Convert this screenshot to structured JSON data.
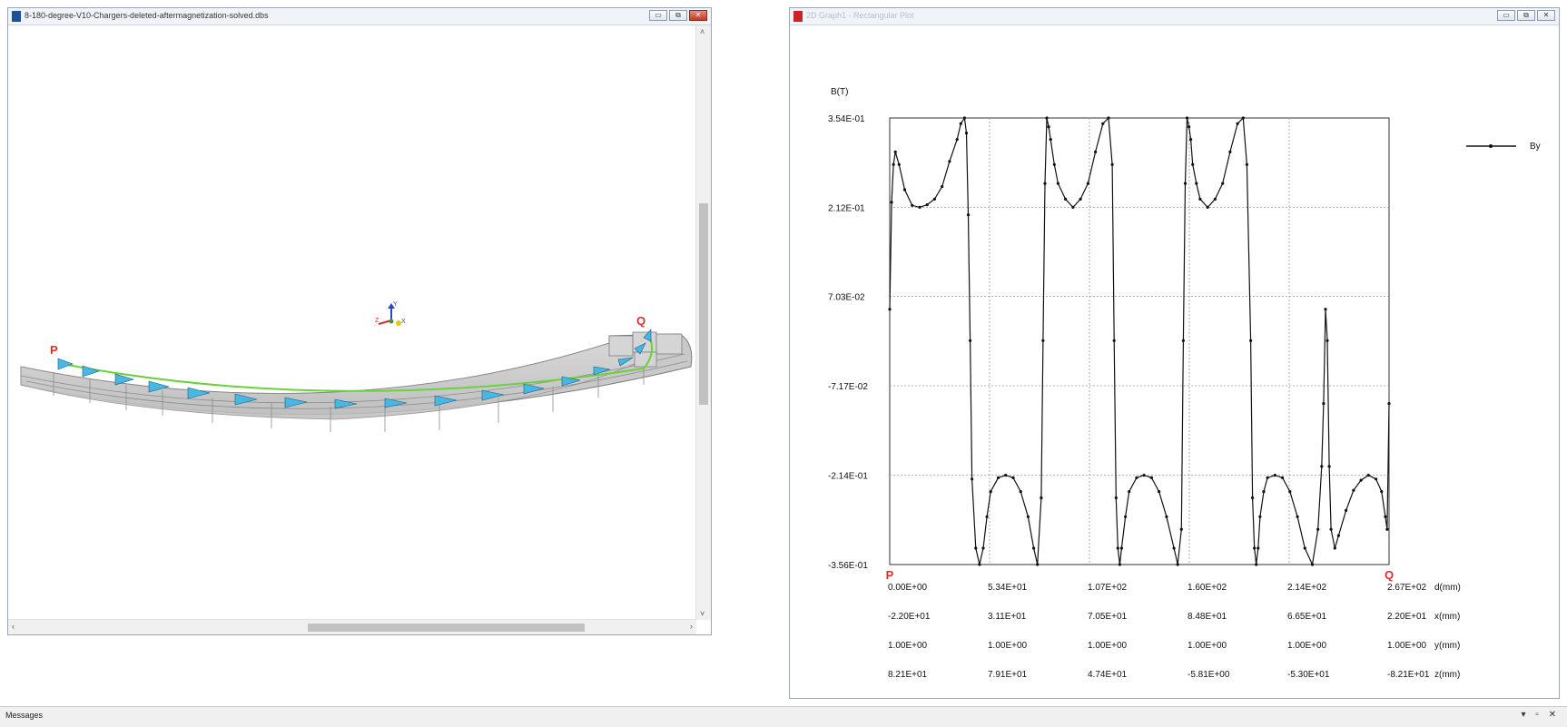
{
  "left_window": {
    "title": "8-180-degree-V10-Chargers-deleted-aftermagnetization-solved.dbs",
    "buttons": [
      "▭",
      "⧉",
      "✕"
    ],
    "labels": {
      "start": "P",
      "end": "Q"
    },
    "axis_labels": {
      "y": "Y",
      "x": "X",
      "z": "Z"
    }
  },
  "right_window": {
    "title": "2D Graph1 - Rectangular Plot",
    "buttons": [
      "▭",
      "⧉",
      "✕"
    ]
  },
  "statusbar": {
    "label": "Messages",
    "controls": "▾ ▫ ✕"
  },
  "chart_data": {
    "type": "line",
    "ylabel": "B(T)",
    "legend": {
      "entries": [
        "By"
      ],
      "position": "top-right"
    },
    "y_ticks": [
      "3.54E-01",
      "2.12E-01",
      "7.03E-02",
      "-7.17E-02",
      "-2.14E-01",
      "-3.56E-01"
    ],
    "ylim": [
      -0.356,
      0.354
    ],
    "xlim": [
      0,
      267
    ],
    "grid": true,
    "endpoint_labels": [
      "P",
      "Q"
    ],
    "x_axes": [
      {
        "label": "d(mm)",
        "ticks": [
          "0.00E+00",
          "5.34E+01",
          "1.07E+02",
          "1.60E+02",
          "2.14E+02",
          "2.67E+02"
        ]
      },
      {
        "label": "x(mm)",
        "ticks": [
          "-2.20E+01",
          "3.11E+01",
          "7.05E+01",
          "8.48E+01",
          "6.65E+01",
          "2.20E+01"
        ]
      },
      {
        "label": "y(mm)",
        "ticks": [
          "1.00E+00",
          "1.00E+00",
          "1.00E+00",
          "1.00E+00",
          "1.00E+00",
          "1.00E+00"
        ]
      },
      {
        "label": "z(mm)",
        "ticks": [
          "8.21E+01",
          "7.91E+01",
          "4.74E+01",
          "-5.81E+00",
          "-5.30E+01",
          "-8.21E+01"
        ]
      }
    ],
    "series": [
      {
        "name": "By",
        "x": [
          0,
          1,
          2,
          3,
          5,
          8,
          12,
          16,
          20,
          24,
          28,
          32,
          36,
          38,
          40,
          41,
          42,
          43,
          44,
          46,
          48,
          50,
          52,
          54,
          58,
          62,
          66,
          70,
          74,
          77,
          79,
          81,
          82,
          83,
          84,
          85,
          86,
          88,
          90,
          94,
          98,
          102,
          106,
          110,
          114,
          117,
          119,
          120,
          121,
          122,
          123,
          124,
          126,
          128,
          132,
          136,
          140,
          144,
          148,
          152,
          154,
          156,
          157,
          158,
          159,
          160,
          161,
          162,
          164,
          166,
          170,
          174,
          178,
          182,
          186,
          189,
          191,
          193,
          194,
          195,
          196,
          197,
          198,
          200,
          202,
          206,
          210,
          214,
          218,
          222,
          226,
          229,
          231,
          232,
          233,
          234,
          235,
          236,
          238,
          240,
          244,
          248,
          252,
          256,
          260,
          263,
          265,
          266,
          267
        ],
        "values": [
          0.05,
          0.22,
          0.28,
          0.3,
          0.28,
          0.24,
          0.215,
          0.212,
          0.216,
          0.225,
          0.245,
          0.285,
          0.32,
          0.345,
          0.354,
          0.33,
          0.2,
          0.0,
          -0.22,
          -0.33,
          -0.356,
          -0.33,
          -0.28,
          -0.24,
          -0.218,
          -0.214,
          -0.218,
          -0.24,
          -0.28,
          -0.33,
          -0.356,
          -0.25,
          0.0,
          0.25,
          0.354,
          0.34,
          0.32,
          0.28,
          0.25,
          0.225,
          0.212,
          0.225,
          0.25,
          0.3,
          0.345,
          0.354,
          0.28,
          0.0,
          -0.25,
          -0.33,
          -0.356,
          -0.33,
          -0.28,
          -0.24,
          -0.218,
          -0.214,
          -0.218,
          -0.24,
          -0.28,
          -0.33,
          -0.356,
          -0.3,
          0.0,
          0.25,
          0.354,
          0.34,
          0.32,
          0.28,
          0.25,
          0.225,
          0.212,
          0.225,
          0.25,
          0.3,
          0.345,
          0.354,
          0.28,
          0.0,
          -0.25,
          -0.33,
          -0.356,
          -0.33,
          -0.28,
          -0.24,
          -0.218,
          -0.214,
          -0.218,
          -0.24,
          -0.28,
          -0.33,
          -0.356,
          -0.3,
          -0.2,
          -0.1,
          0.05,
          0.0,
          -0.2,
          -0.3,
          -0.33,
          -0.31,
          -0.27,
          -0.238,
          -0.222,
          -0.214,
          -0.22,
          -0.24,
          -0.28,
          -0.3,
          -0.1
        ]
      }
    ]
  }
}
